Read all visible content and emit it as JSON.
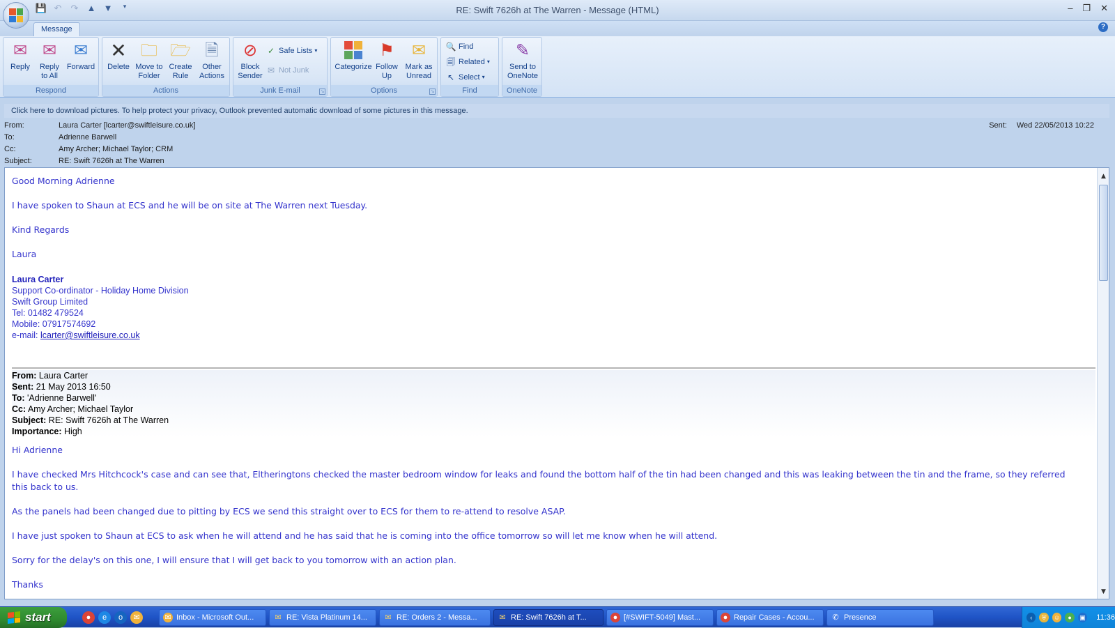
{
  "window": {
    "title": "RE: Swift 7626h at The Warren - Message (HTML)",
    "controls": [
      "–",
      "❐",
      "✕"
    ]
  },
  "qat": {
    "icons": [
      "save-icon",
      "undo-icon",
      "redo-icon",
      "previous-item-icon",
      "next-item-icon",
      "customize-qat-icon"
    ]
  },
  "tabs": [
    {
      "label": "Message"
    }
  ],
  "ribbon": {
    "respond": {
      "label": "Respond",
      "reply": "Reply",
      "reply_all": [
        "Reply",
        "to All"
      ],
      "forward": "Forward"
    },
    "actions": {
      "label": "Actions",
      "delete": "Delete",
      "move_to_folder": [
        "Move to",
        "Folder"
      ],
      "create_rule": [
        "Create",
        "Rule"
      ],
      "other_actions": [
        "Other",
        "Actions"
      ]
    },
    "junk": {
      "label": "Junk E-mail",
      "block_sender": [
        "Block",
        "Sender"
      ],
      "safe_lists": "Safe Lists",
      "not_junk": "Not Junk"
    },
    "options": {
      "label": "Options",
      "categorize": "Categorize",
      "follow_up": [
        "Follow",
        "Up"
      ],
      "mark_unread": [
        "Mark as",
        "Unread"
      ]
    },
    "find": {
      "label": "Find",
      "find": "Find",
      "related": "Related",
      "select": "Select"
    },
    "onenote": {
      "label": "OneNote",
      "send": [
        "Send to",
        "OneNote"
      ]
    }
  },
  "infobar": "Click here to download pictures. To help protect your privacy, Outlook prevented automatic download of some pictures in this message.",
  "header": {
    "from_label": "From:",
    "from": "Laura Carter [lcarter@swiftleisure.co.uk]",
    "to_label": "To:",
    "to": "Adrienne Barwell",
    "cc_label": "Cc:",
    "cc": "Amy Archer; Michael Taylor; CRM",
    "subject_label": "Subject:",
    "subject": "RE: Swift 7626h at The Warren",
    "sent_label": "Sent:",
    "sent": "Wed 22/05/2013 10:22"
  },
  "body": {
    "greeting": "Good Morning Adrienne",
    "p1": "I have spoken to Shaun at ECS and he will be on site at The Warren next Tuesday.",
    "regards": "Kind Regards",
    "name": "Laura",
    "sig_name": "Laura Carter",
    "sig_title": "Support Co-ordinator - Holiday Home Division",
    "sig_company": "Swift Group Limited",
    "sig_tel": "Tel: 01482 479524",
    "sig_mobile": "Mobile: 07917574692",
    "sig_email_label": "e-mail: ",
    "sig_email": "lcarter@swiftleisure.co.uk"
  },
  "quoted": {
    "from_label": "From:",
    "from": " Laura Carter",
    "sent_label": "Sent:",
    "sent": " 21 May 2013 16:50",
    "to_label": "To:",
    "to": " 'Adrienne Barwell'",
    "cc_label": "Cc:",
    "cc": " Amy Archer; Michael Taylor",
    "subject_label": "Subject:",
    "subject": " RE: Swift 7626h at The Warren",
    "importance_label": "Importance:",
    "importance": " High",
    "greeting": "Hi Adrienne",
    "p1": "I have checked Mrs Hitchcock's case and can see that, Eltheringtons checked the master bedroom window for leaks and found the bottom half of the tin had been changed and this was leaking between the tin and the frame, so they referred this back to us.",
    "p2": "As the panels had been changed due to pitting by ECS we send this straight over to ECS for them to re-attend to resolve ASAP.",
    "p3": "I have just spoken to Shaun at ECS to ask when he will attend and he has said that he is coming into the office tomorrow so will let me know when he will attend.",
    "p4": "Sorry for the delay's on this one, I will ensure that I will get back to you tomorrow with an action plan.",
    "thanks": "Thanks"
  },
  "taskbar": {
    "start": "start",
    "tasks": [
      {
        "label": "Inbox - Microsoft Out...",
        "icon": "outlook-icon"
      },
      {
        "label": "RE: Vista Platinum 14...",
        "icon": "mail-icon"
      },
      {
        "label": "RE: Orders 2 - Messa...",
        "icon": "mail-icon"
      },
      {
        "label": "RE: Swift 7626h at T...",
        "icon": "mail-icon"
      },
      {
        "label": "[#SWIFT-5049] Mast...",
        "icon": "chrome-icon"
      },
      {
        "label": "Repair Cases - Accou...",
        "icon": "chrome-icon"
      },
      {
        "label": "Presence",
        "icon": "presence-icon"
      }
    ],
    "clock": "11:36"
  },
  "colors": {
    "ribbon_text": "#15428b",
    "body_text": "#3333cc",
    "taskbar": "#245edb",
    "start": "#3c9e3c"
  }
}
